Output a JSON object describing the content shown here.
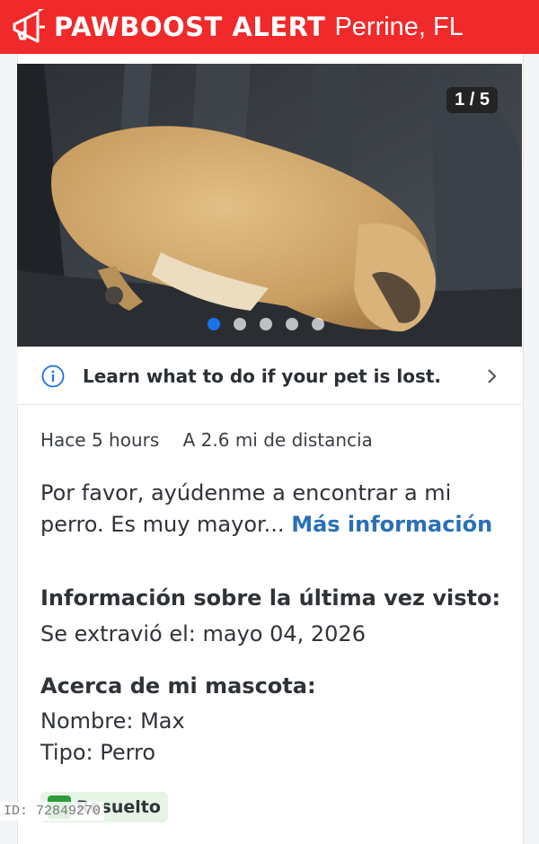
{
  "header": {
    "brand": "PAWBOOST ALERT",
    "location": "Perrine, FL",
    "icon": "megaphone-icon",
    "bg_color": "#f0292a"
  },
  "photo": {
    "counter": "1 / 5",
    "total_images": 5,
    "current_index": 1
  },
  "tip": {
    "icon": "info-icon",
    "text": "Learn what to do if your pet is lost."
  },
  "meta": {
    "time": "Hace 5 hours",
    "distance": "A 2.6 mi de distancia"
  },
  "description": {
    "text": "Por favor, ayúdenme a encontrar a mi perro. Es muy mayor...",
    "more_link": "Más información"
  },
  "last_seen": {
    "heading": "Información sobre la última vez visto:",
    "date": "Se extravió el: mayo 04, 2026"
  },
  "about": {
    "heading": "Acerca de mi mascota:",
    "name": "Nombre: Max",
    "type": "Tipo: Perro"
  },
  "status": {
    "label": "Resuelto",
    "color": "#2e9b3a"
  },
  "id_tag": "ID: 72849270"
}
